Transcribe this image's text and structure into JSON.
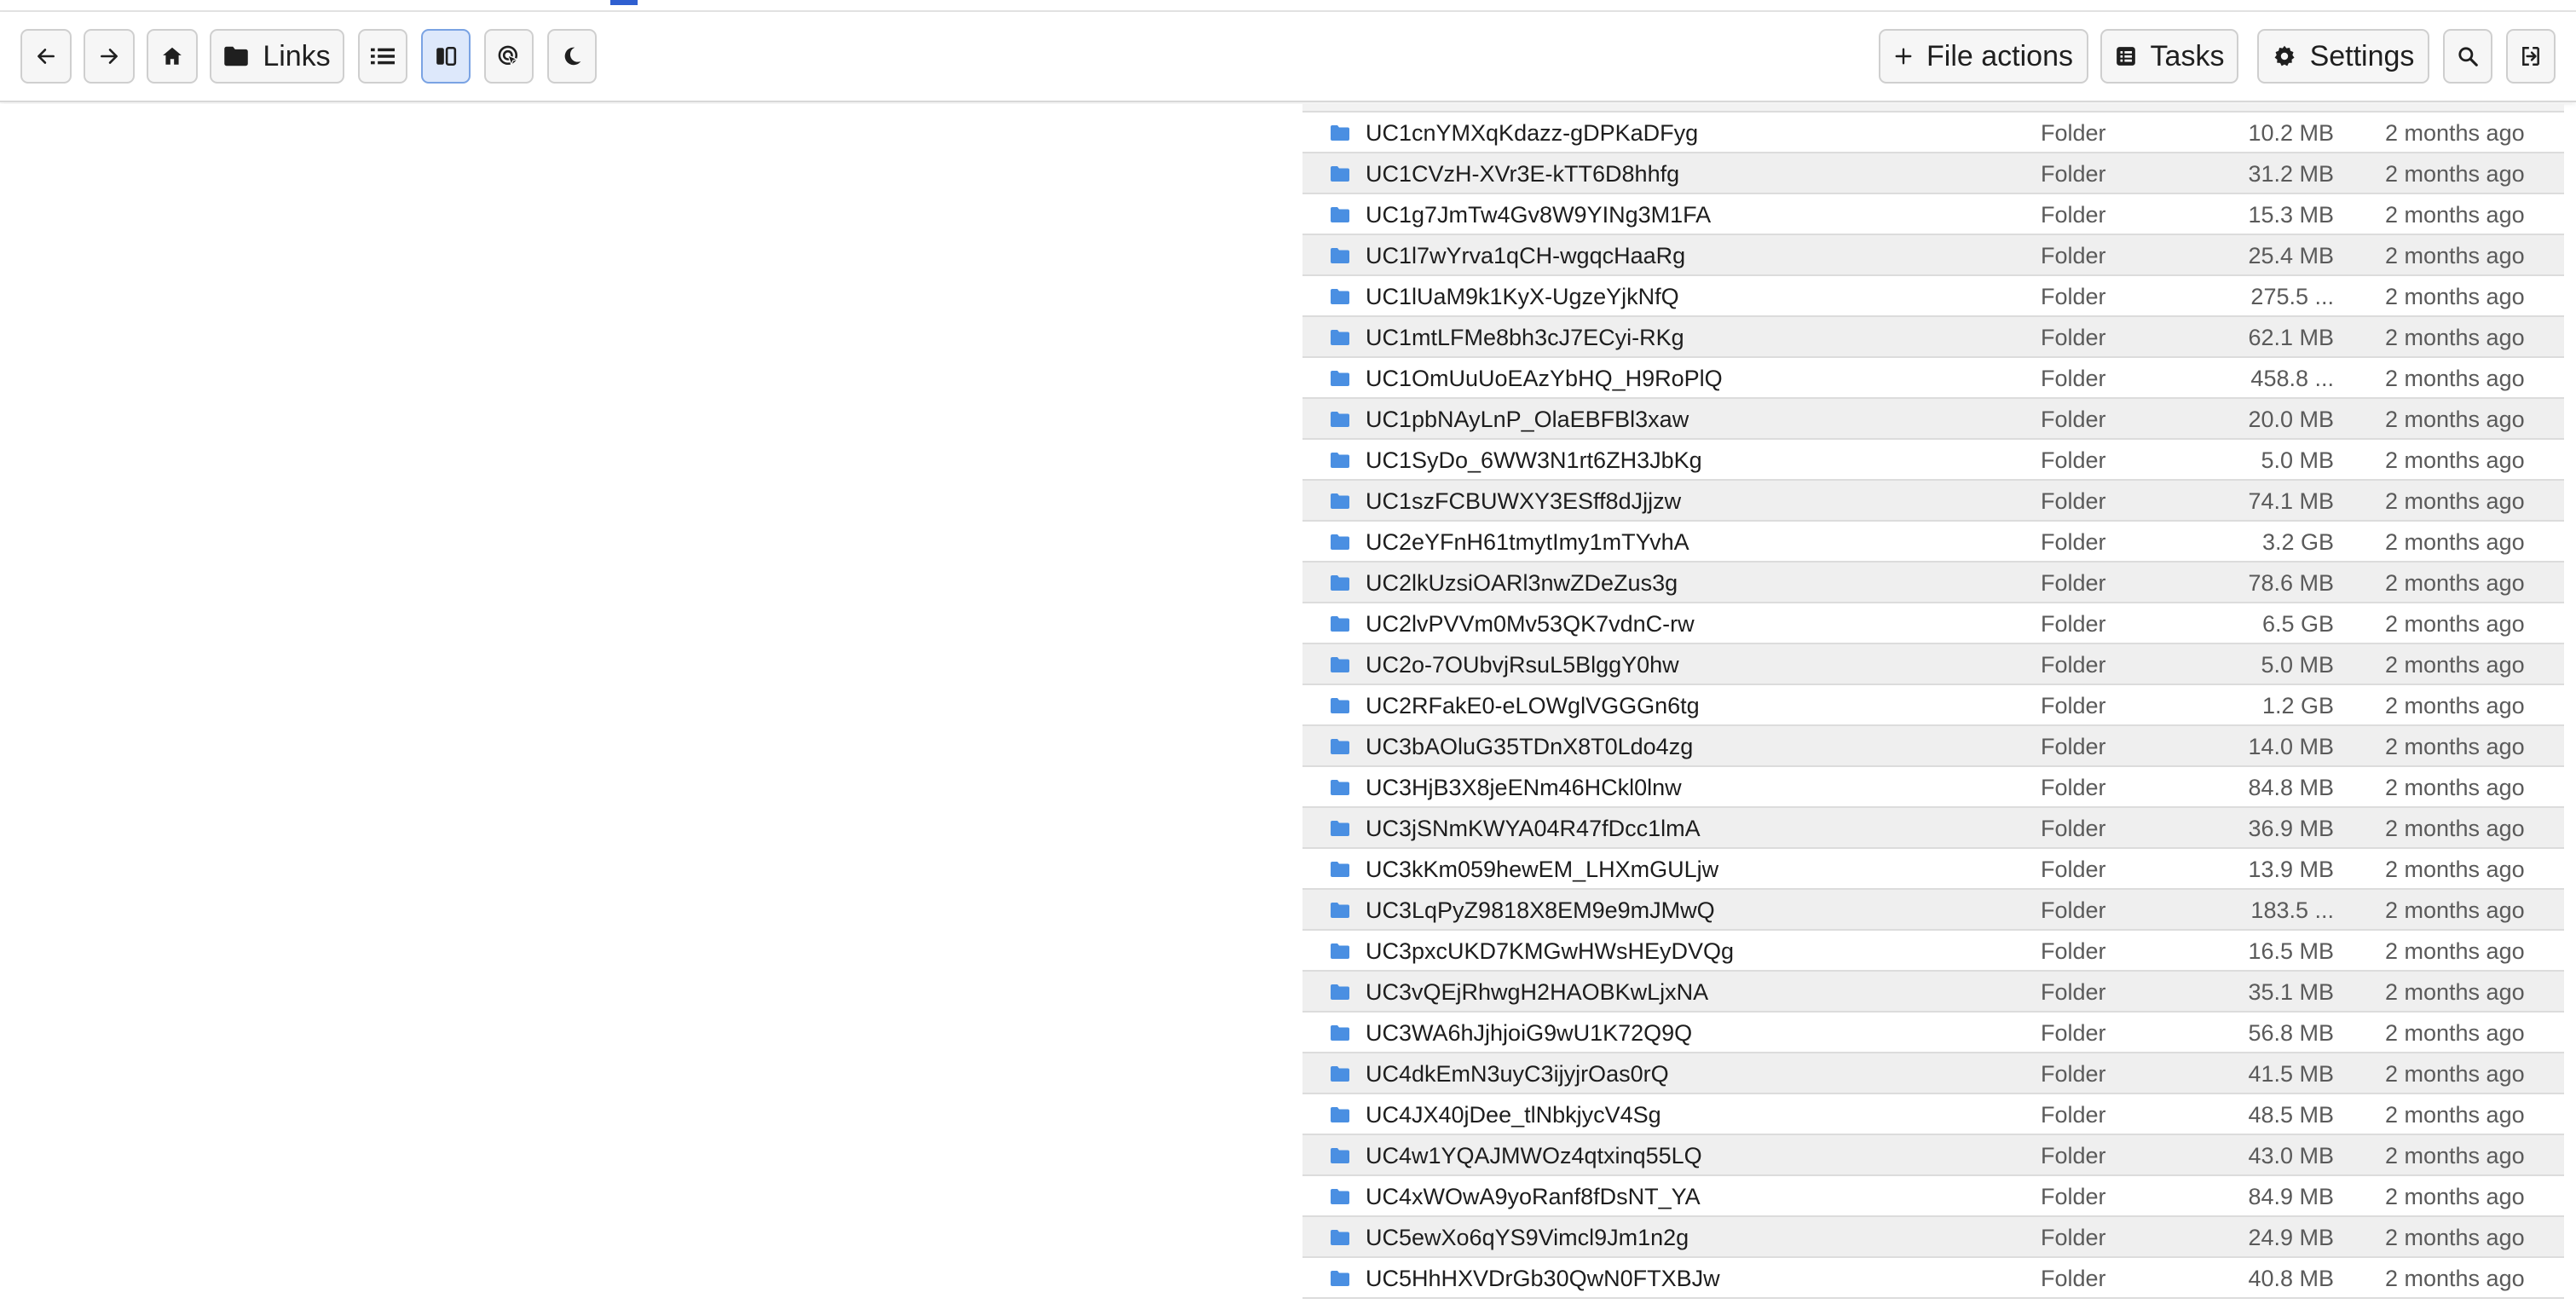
{
  "toolbar": {
    "links_label": "Links",
    "file_actions_label": "File actions",
    "tasks_label": "Tasks",
    "settings_label": "Settings"
  },
  "rows": [
    {
      "name": "UC1cnYMXqKdazz-gDPKaDFyg",
      "type": "Folder",
      "size": "10.2 MB",
      "modified": "2 months ago"
    },
    {
      "name": "UC1CVzH-XVr3E-kTT6D8hhfg",
      "type": "Folder",
      "size": "31.2 MB",
      "modified": "2 months ago"
    },
    {
      "name": "UC1g7JmTw4Gv8W9YINg3M1FA",
      "type": "Folder",
      "size": "15.3 MB",
      "modified": "2 months ago"
    },
    {
      "name": "UC1l7wYrva1qCH-wgqcHaaRg",
      "type": "Folder",
      "size": "25.4 MB",
      "modified": "2 months ago"
    },
    {
      "name": "UC1lUaM9k1KyX-UgzeYjkNfQ",
      "type": "Folder",
      "size": "275.5 ...",
      "modified": "2 months ago"
    },
    {
      "name": "UC1mtLFMe8bh3cJ7ECyi-RKg",
      "type": "Folder",
      "size": "62.1 MB",
      "modified": "2 months ago"
    },
    {
      "name": "UC1OmUuUoEAzYbHQ_H9RoPlQ",
      "type": "Folder",
      "size": "458.8 ...",
      "modified": "2 months ago"
    },
    {
      "name": "UC1pbNAyLnP_OlaEBFBl3xaw",
      "type": "Folder",
      "size": "20.0 MB",
      "modified": "2 months ago"
    },
    {
      "name": "UC1SyDo_6WW3N1rt6ZH3JbKg",
      "type": "Folder",
      "size": "5.0 MB",
      "modified": "2 months ago"
    },
    {
      "name": "UC1szFCBUWXY3ESff8dJjjzw",
      "type": "Folder",
      "size": "74.1 MB",
      "modified": "2 months ago"
    },
    {
      "name": "UC2eYFnH61tmytImy1mTYvhA",
      "type": "Folder",
      "size": "3.2 GB",
      "modified": "2 months ago"
    },
    {
      "name": "UC2lkUzsiOARl3nwZDeZus3g",
      "type": "Folder",
      "size": "78.6 MB",
      "modified": "2 months ago"
    },
    {
      "name": "UC2lvPVVm0Mv53QK7vdnC-rw",
      "type": "Folder",
      "size": "6.5 GB",
      "modified": "2 months ago"
    },
    {
      "name": "UC2o-7OUbvjRsuL5BlggY0hw",
      "type": "Folder",
      "size": "5.0 MB",
      "modified": "2 months ago"
    },
    {
      "name": "UC2RFakE0-eLOWglVGGGn6tg",
      "type": "Folder",
      "size": "1.2 GB",
      "modified": "2 months ago"
    },
    {
      "name": "UC3bAOluG35TDnX8T0Ldo4zg",
      "type": "Folder",
      "size": "14.0 MB",
      "modified": "2 months ago"
    },
    {
      "name": "UC3HjB3X8jeENm46HCkl0lnw",
      "type": "Folder",
      "size": "84.8 MB",
      "modified": "2 months ago"
    },
    {
      "name": "UC3jSNmKWYA04R47fDcc1lmA",
      "type": "Folder",
      "size": "36.9 MB",
      "modified": "2 months ago"
    },
    {
      "name": "UC3kKm059hewEM_LHXmGULjw",
      "type": "Folder",
      "size": "13.9 MB",
      "modified": "2 months ago"
    },
    {
      "name": "UC3LqPyZ9818X8EM9e9mJMwQ",
      "type": "Folder",
      "size": "183.5 ...",
      "modified": "2 months ago"
    },
    {
      "name": "UC3pxcUKD7KMGwHWsHEyDVQg",
      "type": "Folder",
      "size": "16.5 MB",
      "modified": "2 months ago"
    },
    {
      "name": "UC3vQEjRhwgH2HAOBKwLjxNA",
      "type": "Folder",
      "size": "35.1 MB",
      "modified": "2 months ago"
    },
    {
      "name": "UC3WA6hJjhjoiG9wU1K72Q9Q",
      "type": "Folder",
      "size": "56.8 MB",
      "modified": "2 months ago"
    },
    {
      "name": "UC4dkEmN3uyC3ijyjrOas0rQ",
      "type": "Folder",
      "size": "41.5 MB",
      "modified": "2 months ago"
    },
    {
      "name": "UC4JX40jDee_tlNbkjycV4Sg",
      "type": "Folder",
      "size": "48.5 MB",
      "modified": "2 months ago"
    },
    {
      "name": "UC4w1YQAJMWOz4qtxinq55LQ",
      "type": "Folder",
      "size": "43.0 MB",
      "modified": "2 months ago"
    },
    {
      "name": "UC4xWOwA9yoRanf8fDsNT_YA",
      "type": "Folder",
      "size": "84.9 MB",
      "modified": "2 months ago"
    },
    {
      "name": "UC5ewXo6qYS9Vimcl9Jm1n2g",
      "type": "Folder",
      "size": "24.9 MB",
      "modified": "2 months ago"
    },
    {
      "name": "UC5HhHXVDrGb30QwN0FTXBJw",
      "type": "Folder",
      "size": "40.8 MB",
      "modified": "2 months ago"
    }
  ]
}
